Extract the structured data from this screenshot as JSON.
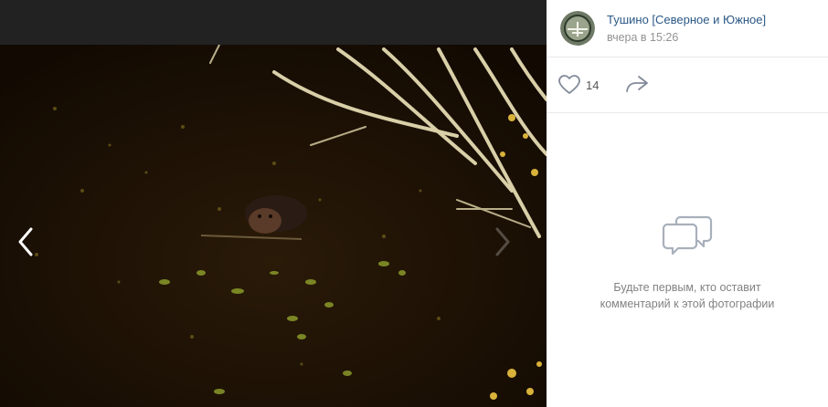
{
  "author": {
    "name": "Тушино [Северное и Южное]",
    "time": "вчера в 15:26",
    "avatar_icon": "community-avatar-icon"
  },
  "actions": {
    "likes_count": "14",
    "like_icon": "heart-icon",
    "share_icon": "share-arrow-icon"
  },
  "comments": {
    "empty_text_line1": "Будьте первым, кто оставит",
    "empty_text_line2": "комментарий к этой фотографии",
    "icon": "comments-icon"
  },
  "viewer": {
    "prev_icon": "chevron-left-icon",
    "next_icon": "chevron-right-icon",
    "photo": "night-river-beaver-photo"
  },
  "colors": {
    "link": "#2a5885",
    "muted": "#939393",
    "divider": "#e7e8ec",
    "topbar": "#222222"
  }
}
